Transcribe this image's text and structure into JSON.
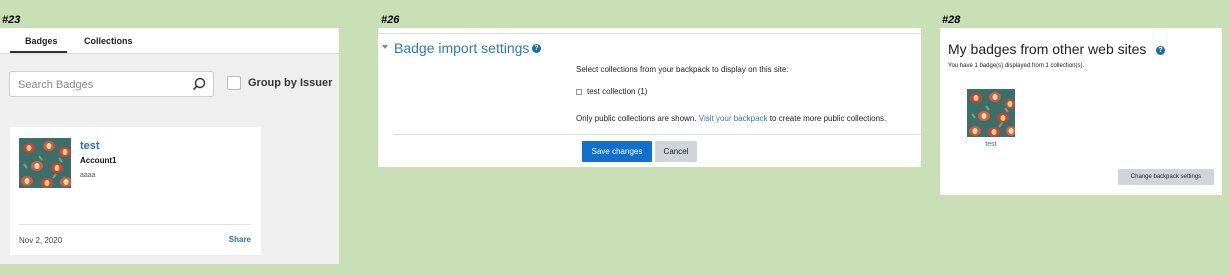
{
  "panel1": {
    "tag": "#23",
    "tabs": [
      "Badges",
      "Collections"
    ],
    "search_placeholder": "Search Badges",
    "group_by_label": "Group by Issuer",
    "card": {
      "name": "test",
      "issuer": "Account1",
      "description": "aaaa",
      "date": "Nov 2, 2020",
      "share_label": "Share"
    }
  },
  "panel2": {
    "tag": "#26",
    "heading": "Badge import settings",
    "help": "?",
    "instruction": "Select collections from your backpack to display on this site:",
    "collection_label": "test collection (1)",
    "note_before": "Only public collections are shown.",
    "note_link": "Visit your backpack",
    "note_after": "to create more public collections.",
    "save_label": "Save changes",
    "cancel_label": "Cancel"
  },
  "panel3": {
    "tag": "#28",
    "title": "My badges from other web sites",
    "help": "?",
    "subtitle": "You have 1 badge(s) displayed from 1 collection(s).",
    "badge_label": "test",
    "button_label": "Change backpack settings"
  }
}
